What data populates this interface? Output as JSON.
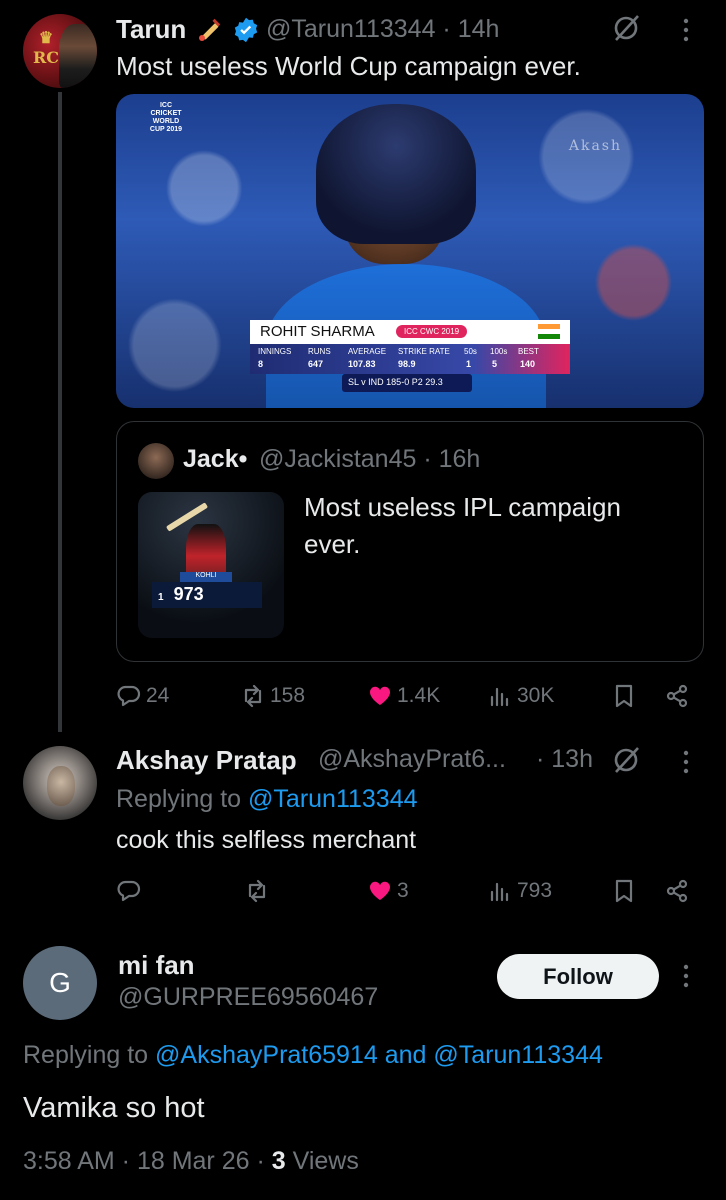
{
  "tweet": {
    "author_name": "Tarun",
    "handle": "@Tarun113344",
    "time": "14h",
    "text": "Most useless World Cup campaign ever.",
    "media": {
      "watermark": "Akash",
      "event_logo": "ICC CRICKET WORLD CUP 2019",
      "player": "ROHIT SHARMA",
      "tag": "ICC CWC 2019",
      "headers": [
        "INNINGS",
        "RUNS",
        "AVERAGE",
        "STRIKE RATE",
        "50s",
        "100s",
        "BEST"
      ],
      "values": [
        "8",
        "647",
        "107.83",
        "98.9",
        "1",
        "5",
        "140"
      ],
      "score": "SL v IND 185-0 P2 29.3"
    },
    "quote": {
      "author_name": "Jack•",
      "handle": "@Jackistan45",
      "time": "16h",
      "text": "Most useless IPL campaign ever.",
      "thumb_name": "KOHLI",
      "thumb_rank": "1",
      "thumb_score": "973"
    },
    "stats": {
      "replies": "24",
      "retweets": "158",
      "likes": "1.4K",
      "views": "30K"
    }
  },
  "reply1": {
    "author_name": "Akshay Pratap",
    "handle": "@AkshayPrat6...",
    "time": "13h",
    "replying_prefix": "Replying to",
    "replying_to": "@Tarun113344",
    "text": "cook this selfless merchant",
    "stats": {
      "likes": "3",
      "views": "793"
    }
  },
  "reply2": {
    "avatar_letter": "G",
    "author_name": "mi fan",
    "handle": "@GURPREE69560467",
    "follow_label": "Follow",
    "replying_prefix": "Replying to",
    "replying_to_1": "@AkshayPrat65914",
    "replying_and": "and",
    "replying_to_2": "@Tarun113344",
    "text": "Vamika so hot",
    "time": "3:58 AM",
    "date": "18 Mar 26",
    "views_count": "3",
    "views_label": "Views"
  },
  "colors": {
    "accent": "#1d9bf0",
    "like": "#f91880",
    "muted": "#71767b",
    "text": "#e7e9ea",
    "background": "#000000"
  }
}
